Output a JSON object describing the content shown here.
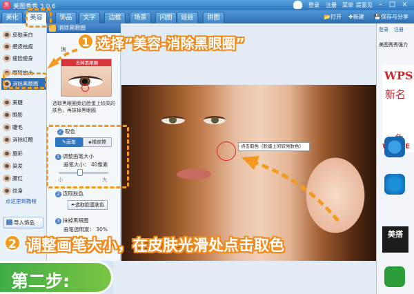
{
  "app": {
    "title": "美图秀秀 3.0.6"
  },
  "titlebar": {
    "login": "登录",
    "register": "注册",
    "menu": "菜单",
    "feedback": "提意见"
  },
  "menu_tabs": [
    {
      "label": "美化"
    },
    {
      "label": "美容"
    },
    {
      "label": "饰品"
    },
    {
      "label": "文字"
    },
    {
      "label": "边框"
    },
    {
      "label": "场景"
    },
    {
      "label": "闪图"
    },
    {
      "label": "娃娃"
    },
    {
      "label": "拼图"
    }
  ],
  "toolbar_actions": {
    "open": "打开",
    "new": "新建",
    "save": "保存与分享"
  },
  "left_sidebar": {
    "items": [
      {
        "label": "皮肤美白"
      },
      {
        "label": "磨皮祛痘"
      },
      {
        "label": "瘦脸瘦身"
      },
      {
        "label": "眼睛放大"
      },
      {
        "label": "消除黑眼圈"
      },
      {
        "label": "美睫"
      },
      {
        "label": "眼影"
      },
      {
        "label": "睫毛"
      },
      {
        "label": "消除红眼"
      },
      {
        "label": "唇彩"
      },
      {
        "label": "染发"
      },
      {
        "label": "腮红"
      },
      {
        "label": "纹身"
      }
    ],
    "more_link": "点这里到教程",
    "import_button": "导入饰品"
  },
  "tool_panel": {
    "header": "消除黑眼圈",
    "sub": "消",
    "example_tag": "去掉黑眼圈",
    "desc": "选取黑眼圈旁边脸蛋上较高的肤色，再抹掉黑眼圈",
    "section1": "取色",
    "btn_brush": "画笔",
    "btn_eraser": "橡皮擦",
    "step1": "调整画笔大小",
    "brush_size_label": "画笔大小：",
    "brush_size_value": "40像素",
    "slider_min": "小",
    "slider_max": "大",
    "slider_value_fraction": 0.42,
    "step2": "选取肤色",
    "btn_pick": "选取脸蛋肤色",
    "step3": "抹掉黑眼圈",
    "opacity_label": "画笔透明度：",
    "opacity_value": "30%"
  },
  "main": {
    "tooltip": "点击取色（脸蛋上的较亮肤色）"
  },
  "right_sidebar": {
    "top_login": "登录",
    "top_reg": "注册",
    "title": "美图秀秀强力",
    "ad_line1": "WPS",
    "ad_line2": "新名",
    "ad_line3": "免",
    "ad_line4": "Word/E",
    "app_text": "美搭"
  },
  "annotations": {
    "badge1": "1",
    "line1": "选择”美容-消除黑眼圈”",
    "badge2": "2",
    "line2": "调整画笔大小，在皮肤光滑处点击取色",
    "step_label": "第二步:"
  },
  "colors": {
    "accent_orange": "#f39a1e",
    "window_blue": "#2f78c0",
    "step_green": "#5bb845"
  }
}
